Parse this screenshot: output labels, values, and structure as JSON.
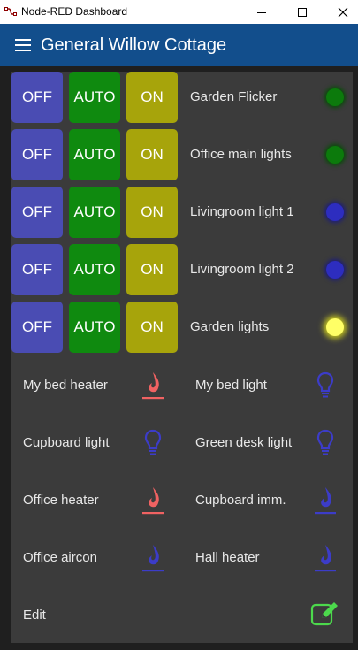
{
  "window": {
    "title": "Node-RED Dashboard"
  },
  "header": {
    "title": "General Willow Cottage"
  },
  "buttons": {
    "off": "OFF",
    "auto": "AUTO",
    "on": "ON"
  },
  "lights": [
    {
      "label": "Garden Flicker",
      "led": "green",
      "led_color": "#0c7a0c"
    },
    {
      "label": "Office main lights",
      "led": "green",
      "led_color": "#0c7a0c"
    },
    {
      "label": "Livingroom light 1",
      "led": "blue",
      "led_color": "#2d2dbf"
    },
    {
      "label": "Livingroom light 2",
      "led": "blue",
      "led_color": "#2d2dbf"
    },
    {
      "label": "Garden lights",
      "led": "yellow",
      "led_color": "#ffff66"
    }
  ],
  "devices": [
    {
      "label": "My bed heater",
      "icon": "flame-icon",
      "color": "#f06262"
    },
    {
      "label": "My bed light",
      "icon": "lightbulb-icon",
      "color": "#3c3cc8"
    },
    {
      "label": "Cupboard light",
      "icon": "lightbulb-icon",
      "color": "#3c3cc8"
    },
    {
      "label": "Green desk light",
      "icon": "lightbulb-icon",
      "color": "#3c3cc8"
    },
    {
      "label": "Office heater",
      "icon": "flame-icon",
      "color": "#f06262"
    },
    {
      "label": "Cupboard imm.",
      "icon": "flame-icon",
      "color": "#3c3cc8"
    },
    {
      "label": "Office aircon",
      "icon": "flame-icon",
      "color": "#3c3cc8"
    },
    {
      "label": "Hall heater",
      "icon": "flame-icon",
      "color": "#3c3cc8"
    }
  ],
  "edit": {
    "label": "Edit",
    "icon": "edit-icon",
    "color": "#4cd94c"
  },
  "colors": {
    "header": "#124e8c",
    "off": "#4a4cb3",
    "auto": "#0f8a0f",
    "on": "#a7a40b",
    "card": "#3b3b3b",
    "background": "#1f1f1f"
  }
}
